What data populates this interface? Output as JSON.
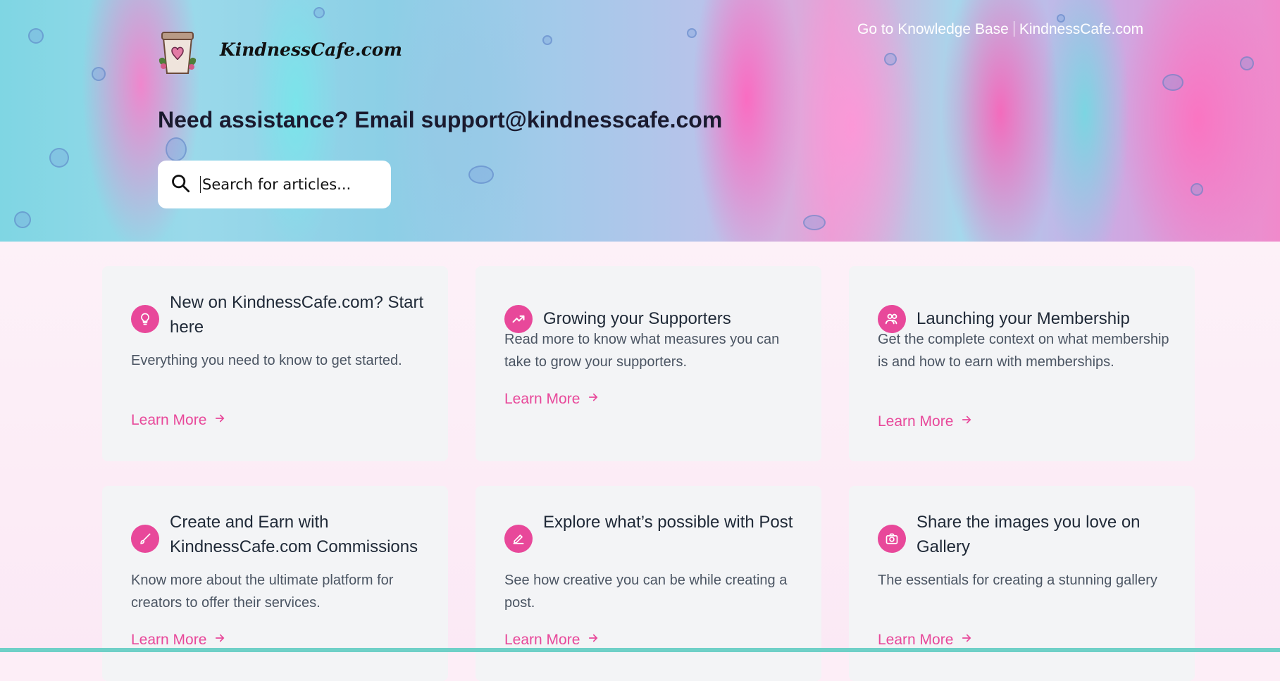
{
  "header": {
    "nav_link_left": "Go to Knowledge Base",
    "nav_link_right": "KindnessCafe.com",
    "logo_text": "KindnessCafe.com",
    "headline": "Need assistance? Email support@kindnesscafe.com"
  },
  "search": {
    "placeholder": "Search for articles..."
  },
  "colors": {
    "accent": "#e8489a",
    "card_bg": "#f3f4f6",
    "page_bg": "#fdeef7"
  },
  "cards": [
    {
      "icon": "lightbulb-icon",
      "title": "New on KindnessCafe.com? Start here",
      "desc": "Everything you need to know to get started.",
      "link": "Learn More"
    },
    {
      "icon": "trending-up-icon",
      "title": "Growing your Supporters",
      "desc": "Read more to know what measures you can take to grow your supporters.",
      "link": "Learn More"
    },
    {
      "icon": "users-icon",
      "title": "Launching your Membership",
      "desc": "Get the complete context on what membership is and how to earn with memberships.",
      "link": "Learn More"
    },
    {
      "icon": "brush-icon",
      "title": "Create and Earn with KindnessCafe.com Commissions",
      "desc": "Know more about the ultimate platform for creators to offer their services.",
      "link": "Learn More"
    },
    {
      "icon": "edit-icon",
      "title": "Explore what’s possible with Post",
      "desc": "See how creative you can be while creating a post.",
      "link": "Learn More"
    },
    {
      "icon": "camera-icon",
      "title": "Share the images you love on Gallery",
      "desc": "The essentials for creating a stunning gallery",
      "link": "Learn More"
    }
  ]
}
